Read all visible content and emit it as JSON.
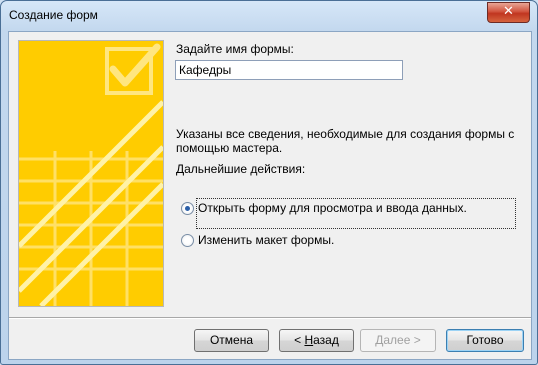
{
  "window": {
    "title": "Создание форм",
    "close_glyph": "✕"
  },
  "form": {
    "name_label": "Задайте имя формы:",
    "name_value": "Кафедры",
    "info_text": "Указаны все сведения, необходимые для создания формы с помощью мастера.",
    "next_actions_label": "Дальнейшие действия:",
    "options": [
      {
        "label": "Открыть форму для просмотра и ввода данных.",
        "checked": true
      },
      {
        "label": "Изменить макет формы.",
        "checked": false
      }
    ]
  },
  "buttons": {
    "cancel": "Отмена",
    "back_prefix": "< ",
    "back_hotkey": "Н",
    "back_rest": "азад",
    "next": "Далее >",
    "finish": "Готово"
  },
  "colors": {
    "hero_yellow": "#ffcc00",
    "accent_blue": "#2b5fa8"
  }
}
